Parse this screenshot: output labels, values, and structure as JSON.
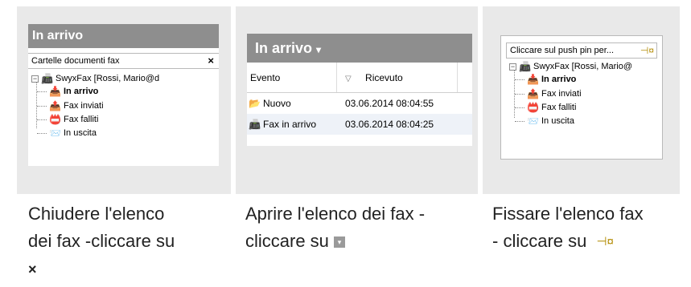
{
  "panel1": {
    "header": "In arrivo",
    "pane_title": "Cartelle documenti fax",
    "close_glyph": "×",
    "tree": {
      "root": "SwyxFax [Rossi, Mario@d",
      "items": [
        "In arrivo",
        "Fax inviati",
        "Fax falliti",
        "In uscita"
      ]
    },
    "caption": {
      "line1": "Chiudere l'elenco",
      "line2": "dei fax -cliccare su",
      "icon_glyph": "×"
    }
  },
  "panel2": {
    "header": "In arrivo",
    "header_dropdown_glyph": "▾",
    "columns": {
      "event": "Evento",
      "received": "Ricevuto",
      "sort_glyph": "▽"
    },
    "rows": [
      {
        "event": "Nuovo",
        "received": "03.06.2014 08:04:55"
      },
      {
        "event": "Fax in arrivo",
        "received": "03.06.2014 08:04:25"
      }
    ],
    "caption": {
      "line1": "Aprire l'elenco dei fax -",
      "line2": "cliccare su",
      "icon_glyph": "▾"
    }
  },
  "panel3": {
    "pane_title": "Cliccare sul push pin per...",
    "pin_glyph": "⊣¤",
    "tree": {
      "root": "SwyxFax [Rossi, Mario@",
      "items": [
        "In arrivo",
        "Fax inviati",
        "Fax falliti",
        "In uscita"
      ]
    },
    "caption": {
      "line1": "Fissare l'elenco fax",
      "line2": "- cliccare su",
      "icon_glyph": "⊣¤"
    }
  },
  "colors": {
    "header_bg": "#8e8e8e",
    "panel_bg": "#e9e9e9",
    "pin": "#b28a00"
  }
}
